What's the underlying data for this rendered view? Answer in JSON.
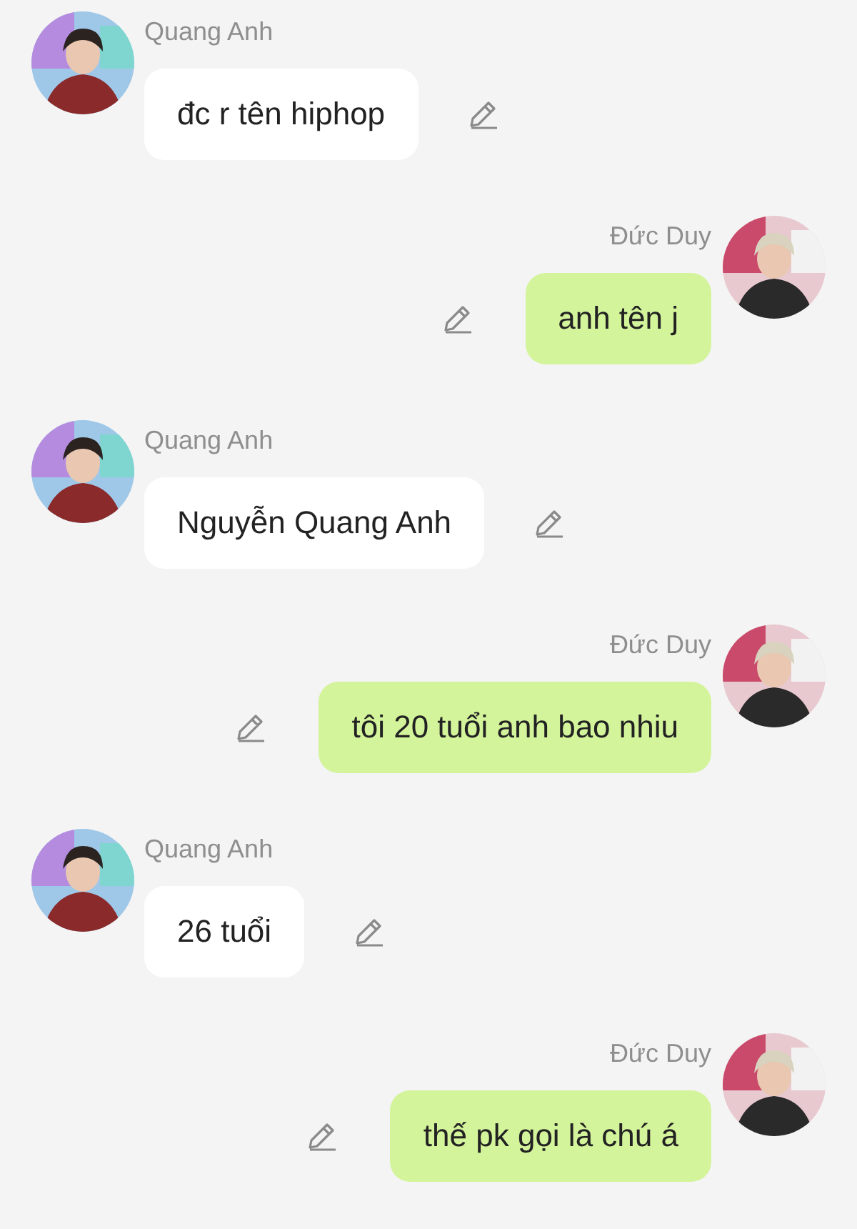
{
  "messages": [
    {
      "kind": "incoming",
      "name": "Quang Anh",
      "text": "đc r tên hiphop"
    },
    {
      "kind": "outgoing",
      "name": "Đức Duy",
      "text": "anh tên j"
    },
    {
      "kind": "incoming",
      "name": "Quang Anh",
      "text": "Nguyễn Quang Anh"
    },
    {
      "kind": "outgoing",
      "name": "Đức Duy",
      "text": "tôi 20 tuổi anh bao nhiu"
    },
    {
      "kind": "incoming",
      "name": "Quang Anh",
      "text": "26 tuổi"
    },
    {
      "kind": "outgoing",
      "name": "Đức Duy",
      "text": "thế pk gọi là chú á"
    }
  ]
}
